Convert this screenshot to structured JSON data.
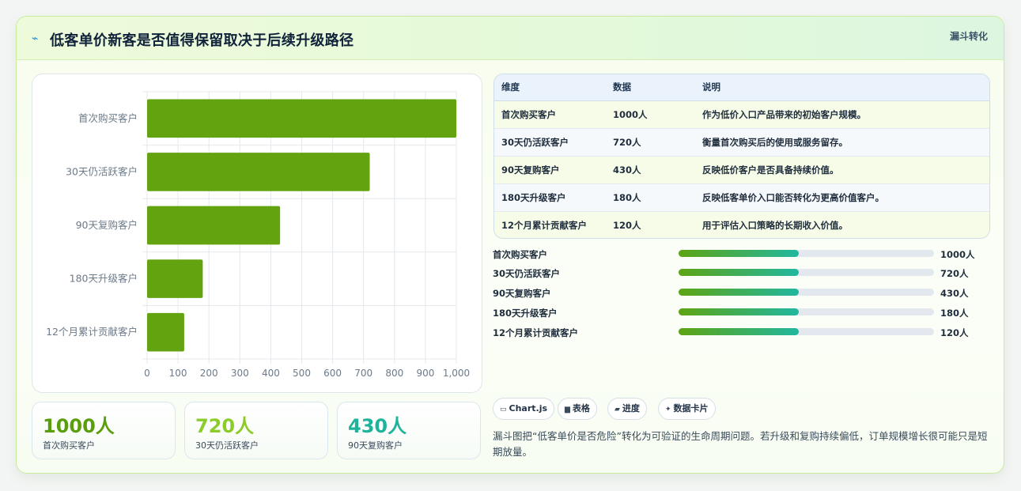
{
  "header": {
    "icon": "lightning-icon",
    "title": "低客单价新客是否值得保留取决于后续升级路径",
    "tag": "漏斗转化"
  },
  "chart_data": {
    "type": "bar",
    "orientation": "horizontal",
    "categories": [
      "首次购买客户",
      "30天仍活跃客户",
      "90天复购客户",
      "180天升级客户",
      "12个月累计贡献客户"
    ],
    "values": [
      1000,
      720,
      430,
      180,
      120
    ],
    "xlim": [
      0,
      1000
    ],
    "xticks": [
      "0",
      "100",
      "200",
      "300",
      "400",
      "500",
      "600",
      "700",
      "800",
      "900",
      "1,000"
    ],
    "bar_color": "#62a30f",
    "grid": true
  },
  "stats": [
    {
      "value": "1000人",
      "label": "首次购买客户",
      "color": "#5a9e0e"
    },
    {
      "value": "720人",
      "label": "30天仍活跃客户",
      "color": "#8ccc2a"
    },
    {
      "value": "430人",
      "label": "90天复购客户",
      "color": "#1fb39c"
    }
  ],
  "table": {
    "headers": [
      "维度",
      "数据",
      "说明"
    ],
    "rows": [
      [
        "首次购买客户",
        "1000人",
        "作为低价入口产品带来的初始客户规模。"
      ],
      [
        "30天仍活跃客户",
        "720人",
        "衡量首次购买后的使用或服务留存。"
      ],
      [
        "90天复购客户",
        "430人",
        "反映低价客户是否具备持续价值。"
      ],
      [
        "180天升级客户",
        "180人",
        "反映低客单价入口能否转化为更高价值客户。"
      ],
      [
        "12个月累计贡献客户",
        "120人",
        "用于评估入口策略的长期收入价值。"
      ]
    ]
  },
  "progress": [
    {
      "label": "首次购买客户",
      "value": "1000人",
      "fill": 0.47
    },
    {
      "label": "30天仍活跃客户",
      "value": "720人",
      "fill": 0.47
    },
    {
      "label": "90天复购客户",
      "value": "430人",
      "fill": 0.47
    },
    {
      "label": "180天升级客户",
      "value": "180人",
      "fill": 0.47
    },
    {
      "label": "12个月累计贡献客户",
      "value": "120人",
      "fill": 0.47
    }
  ],
  "chips": [
    {
      "icon": "▭",
      "icon_name": "chart-icon",
      "label": "Chart.js"
    },
    {
      "icon": "▆",
      "icon_name": "table-icon",
      "label": "表格"
    },
    {
      "icon": "▰",
      "icon_name": "progress-icon",
      "label": "进度"
    },
    {
      "icon": "✦",
      "icon_name": "sparkle-icon",
      "label": "数据卡片"
    }
  ],
  "description": "漏斗图把“低客单价是否危险”转化为可验证的生命周期问题。若升级和复购持续偏低，订单规模增长很可能只是短期放量。"
}
